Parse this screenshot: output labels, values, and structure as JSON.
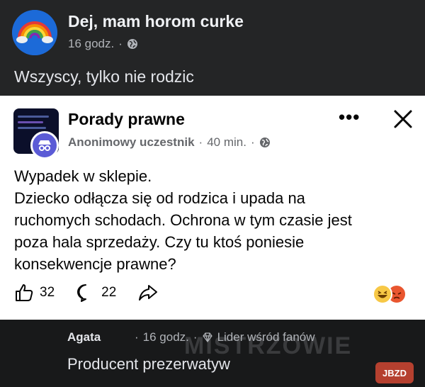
{
  "top_post": {
    "group_name": "Dej, mam horom curke",
    "time": "16 godz.",
    "separator": "·",
    "text": "Wszyscy, tylko nie rodzic"
  },
  "shared_post": {
    "group_name": "Porady prawne",
    "author": "Anonimowy uczestnik",
    "time": "40 min.",
    "separator": "·",
    "more": "•••",
    "body_lines": [
      "Wypadek w sklepie.",
      "Dziecko odłącza się od rodzica i upada na",
      "ruchomych schodach. Ochrona w tym czasie jest",
      "poza hala sprzedaży. Czy tu ktoś poniesie",
      "konsekwencje prawne?"
    ],
    "likes": "32",
    "comments": "22"
  },
  "comment": {
    "author": "Agata",
    "time": "16 godz.",
    "separator": "·",
    "badge": "Lider wśród fanów",
    "text": "Producent prezerwatyw"
  },
  "watermark": {
    "site": "MISTRZOWIE",
    "badge": "JBZD"
  },
  "icons": {
    "globe": "globe-icon",
    "like": "thumbs-up-icon",
    "comment": "comment-bubble-icon",
    "share": "share-arrow-icon",
    "close": "close-icon",
    "diamond": "diamond-icon"
  },
  "colors": {
    "dark_bg": "#242526",
    "card_bg": "#ffffff",
    "comment_bg": "#18191a",
    "anon_badge": "#5b5bd6"
  }
}
